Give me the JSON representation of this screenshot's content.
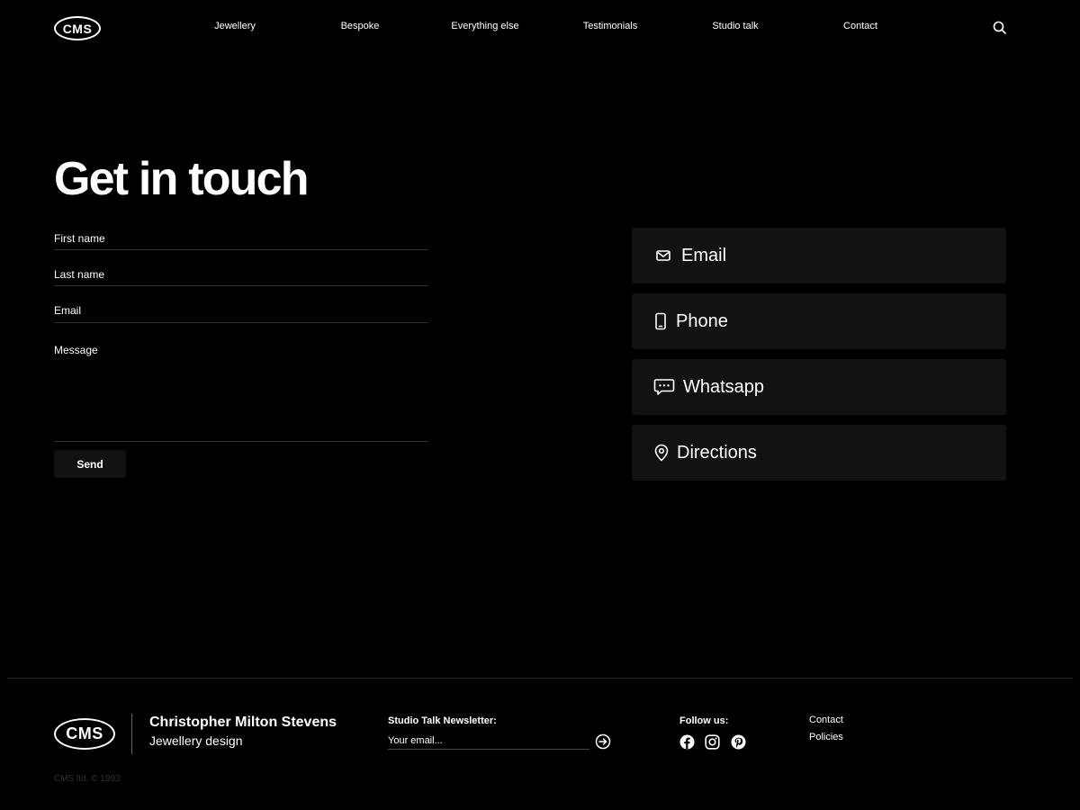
{
  "header": {
    "logo": "CMS",
    "nav": [
      {
        "label": "Jewellery"
      },
      {
        "label": "Bespoke"
      },
      {
        "label": "Everything else"
      },
      {
        "label": "Testimonials"
      },
      {
        "label": "Studio talk"
      },
      {
        "label": "Contact"
      }
    ],
    "search_icon": "search-icon"
  },
  "main": {
    "title": "Get in touch",
    "form": {
      "first_name_label": "First name",
      "last_name_label": "Last name",
      "email_label": "Email",
      "message_label": "Message",
      "send_label": "Send"
    },
    "contact_options": [
      {
        "label": "Email",
        "icon": "mail-icon"
      },
      {
        "label": "Phone",
        "icon": "phone-icon"
      },
      {
        "label": "Whatsapp",
        "icon": "chat-icon"
      },
      {
        "label": "Directions",
        "icon": "location-pin-icon"
      }
    ]
  },
  "footer": {
    "logo": "CMS",
    "brand_name": "Christopher Milton Stevens",
    "brand_tagline": "Jewellery design",
    "newsletter_title": "Studio Talk Newsletter:",
    "newsletter_placeholder": "Your email...",
    "follow_title": "Follow us:",
    "social": [
      "facebook-icon",
      "instagram-icon",
      "pinterest-icon"
    ],
    "links": [
      {
        "label": "Contact"
      },
      {
        "label": "Policies"
      }
    ],
    "copyright": "CMS ltd. © 1993"
  },
  "colors": {
    "background": "#000000",
    "card": "#121214",
    "text": "#ffffff",
    "divider": "#2a2a2a"
  }
}
